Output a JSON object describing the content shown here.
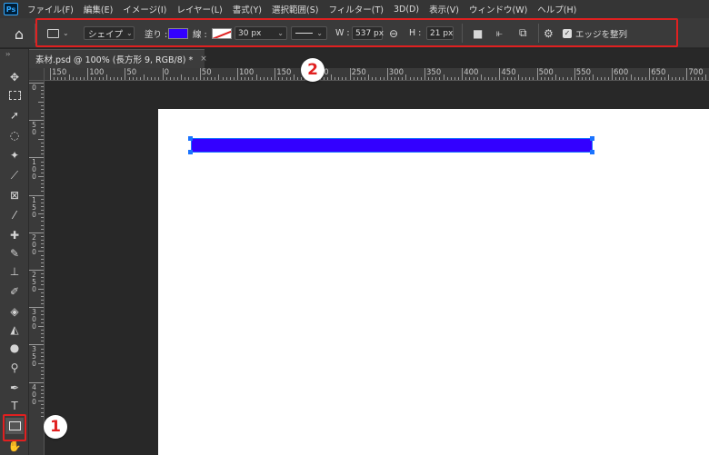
{
  "app": {
    "logo_text": "Ps"
  },
  "menu": [
    "ファイル(F)",
    "編集(E)",
    "イメージ(I)",
    "レイヤー(L)",
    "書式(Y)",
    "選択範囲(S)",
    "フィルター(T)",
    "3D(D)",
    "表示(V)",
    "ウィンドウ(W)",
    "ヘルプ(H)"
  ],
  "options": {
    "mode": "シェイプ",
    "fill_label": "塗り :",
    "fill_color": "#3300ff",
    "stroke_label": "線 :",
    "stroke_width": "30 px",
    "width_label": "W :",
    "width_value": "537 px",
    "height_label": "H :",
    "height_value": "21 px",
    "align_edges_label": "エッジを整列"
  },
  "document_tab": {
    "title": "素材.psd @ 100% (長方形 9, RGB/8) *",
    "close_glyph": "×"
  },
  "ruler": {
    "top_labels": [
      "150",
      "100",
      "50",
      "0",
      "50",
      "100",
      "150",
      "200",
      "250",
      "300",
      "350",
      "400",
      "450",
      "500",
      "550",
      "600",
      "650",
      "700"
    ],
    "left_labels": [
      "0",
      "5\n0",
      "1\n0\n0",
      "1\n5\n0",
      "2\n0\n0",
      "2\n5\n0",
      "3\n0\n0",
      "3\n5\n0",
      "4\n0\n0"
    ]
  },
  "canvas": {
    "shape_color": "#3300ff"
  },
  "annotations": {
    "badge_1": "1",
    "badge_2": "2",
    "highlight_color": "#e02020"
  }
}
